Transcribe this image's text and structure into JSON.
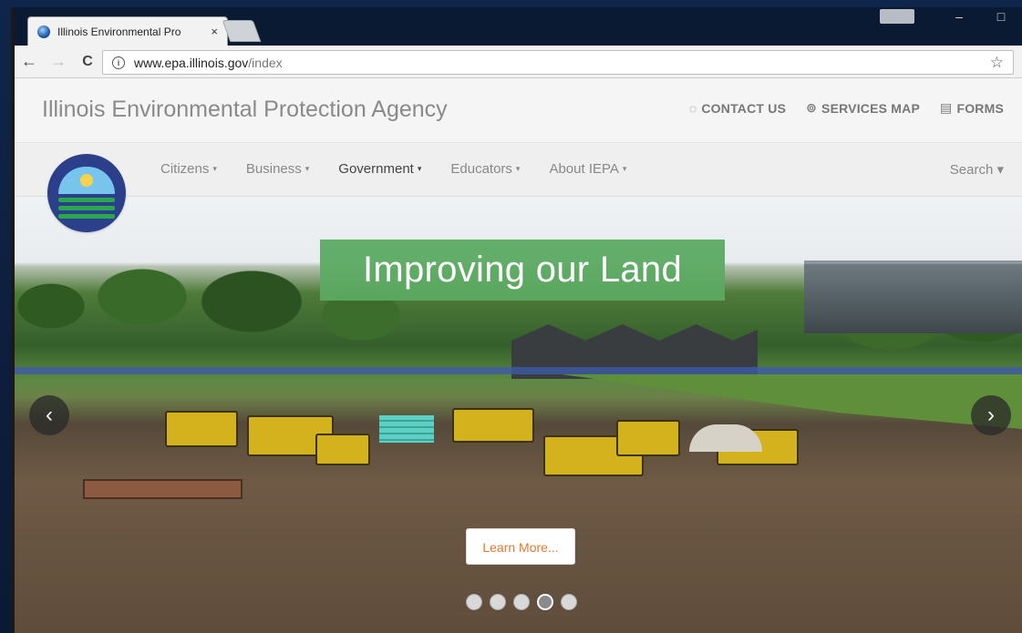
{
  "browser": {
    "tab_title": "Illinois Environmental Pro",
    "tab_close": "×",
    "url_host": "www.epa.illinois.gov",
    "url_path": "/index",
    "user_chip": "",
    "minimize": "–",
    "maximize": "□",
    "back": "←",
    "forward": "→",
    "reload": "C",
    "info": "i",
    "star": "☆"
  },
  "header": {
    "agency_name": "Illinois Environmental Protection Agency",
    "links": [
      {
        "label": "CONTACT US",
        "icon": "chat-icon",
        "glyph": "💬"
      },
      {
        "label": "SERVICES MAP",
        "icon": "map-pin-icon",
        "glyph": "⊙"
      },
      {
        "label": "FORMS",
        "icon": "document-icon",
        "glyph": "▤"
      }
    ]
  },
  "nav": {
    "items": [
      {
        "label": "Citizens",
        "caret": "▾"
      },
      {
        "label": "Business",
        "caret": "▾"
      },
      {
        "label": "Government",
        "caret": "▾"
      },
      {
        "label": "Educators",
        "caret": "▾"
      },
      {
        "label": "About IEPA",
        "caret": "▾"
      }
    ],
    "search": "Search ▾"
  },
  "hero": {
    "title": "Improving our Land",
    "button": "Learn More...",
    "prev": "‹",
    "next": "›",
    "slide_count": 5,
    "active_slide": 4
  },
  "colors": {
    "title_bg": "#5caa62",
    "learn_more_text": "#e07a2e",
    "logo_blue": "#2b3f8a"
  }
}
